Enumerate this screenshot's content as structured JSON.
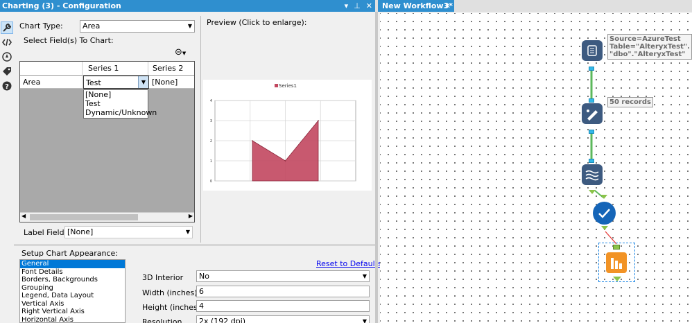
{
  "config": {
    "title": "Charting (3) - Configuration",
    "title_controls": [
      "▾",
      "⊥",
      "✕"
    ],
    "chart_type_label": "Chart Type:",
    "chart_type_value": "Area",
    "select_fields_label": "Select Field(s) To Chart:",
    "grid": {
      "headers": [
        "",
        "Series 1",
        "Series 2"
      ],
      "row": {
        "label": "Area",
        "series1": "Test",
        "series2": "[None]"
      },
      "dropdown_options": [
        "[None]",
        "Test",
        "Dynamic/Unknown"
      ]
    },
    "label_field_label": "Label Field:",
    "label_field_value": "[None]",
    "preview_label": "Preview (Click to enlarge):",
    "setup_label": "Setup Chart Appearance:",
    "reset_link": "Reset to Defaults",
    "setup_items": [
      "General",
      "Font Details",
      "Borders, Backgrounds",
      "Grouping",
      "Legend, Data Layout",
      "Vertical Axis",
      "Right Vertical Axis",
      "Horizontal Axis"
    ],
    "selected_setup_item": "General",
    "fields": {
      "interior_label": "3D Interior",
      "interior_value": "No",
      "width_label": "Width (inches)",
      "width_value": "6",
      "height_label": "Height (inches)",
      "height_value": "4",
      "resolution_label": "Resolution",
      "resolution_value": "2x (192 dpi)"
    }
  },
  "chart_data": {
    "type": "area",
    "series": [
      {
        "name": "Series1",
        "values": [
          2,
          1,
          3
        ]
      }
    ],
    "x": [
      1,
      2,
      3
    ],
    "categories": [],
    "ylim": [
      0,
      4
    ],
    "yticks": [
      0,
      1,
      2,
      3,
      4
    ],
    "grid": true,
    "legend": "top-center",
    "color": "#c2475f"
  },
  "workflow": {
    "tab_title": "New Workflow3*",
    "tab_close": "✕",
    "annotations": {
      "input": "Source=AzureTest\nTable=\"AlteryxTest\".\n\"dbo\".\"AlteryxTest\"",
      "records": "50 records"
    },
    "colors": {
      "input": "#3d5a80",
      "formula": "#3d5a80",
      "transform": "#3d5a80",
      "check": "#1565b8",
      "chart": "#f29325",
      "connector": "#33b8e8",
      "link_green": "#5cb85c"
    }
  }
}
